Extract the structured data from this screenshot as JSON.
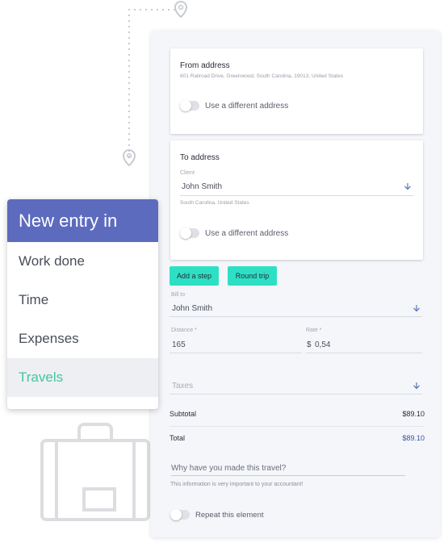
{
  "colors": {
    "accent_teal": "#2de0c4",
    "menu_header": "#5d6bbf",
    "menu_active_text": "#42c89a",
    "icon_blue": "#5b74b8"
  },
  "menu": {
    "title": "New entry in",
    "items": [
      {
        "label": "Work done",
        "active": false
      },
      {
        "label": "Time",
        "active": false
      },
      {
        "label": "Expenses",
        "active": false
      },
      {
        "label": "Travels",
        "active": true
      }
    ]
  },
  "from_address": {
    "title": "From address",
    "address": "601 Railroad Drive, Greenwood, South Carolina, 19013, United States",
    "toggle_label": "Use a different address",
    "toggle_on": false
  },
  "to_address": {
    "title": "To address",
    "client_label": "Client",
    "client_value": "John Smith",
    "location": "South Carolina, United States",
    "toggle_label": "Use a different address",
    "toggle_on": false
  },
  "actions": {
    "add_step": "Add a step",
    "round_trip": "Round trip"
  },
  "bill_to": {
    "label": "Bill to",
    "value": "John Smith"
  },
  "distance": {
    "label": "Distance *",
    "value": "165"
  },
  "rate": {
    "label": "Rate *",
    "currency": "$",
    "value": "0,54"
  },
  "taxes": {
    "placeholder": "Taxes"
  },
  "subtotal": {
    "label": "Subtotal",
    "value": "$89.10"
  },
  "total": {
    "label": "Total",
    "value": "$89.10"
  },
  "reason": {
    "placeholder": "Why have you made this travel?",
    "hint": "This information is very important to your accountant!"
  },
  "repeat": {
    "label": "Repeat this element",
    "toggle_on": false
  }
}
